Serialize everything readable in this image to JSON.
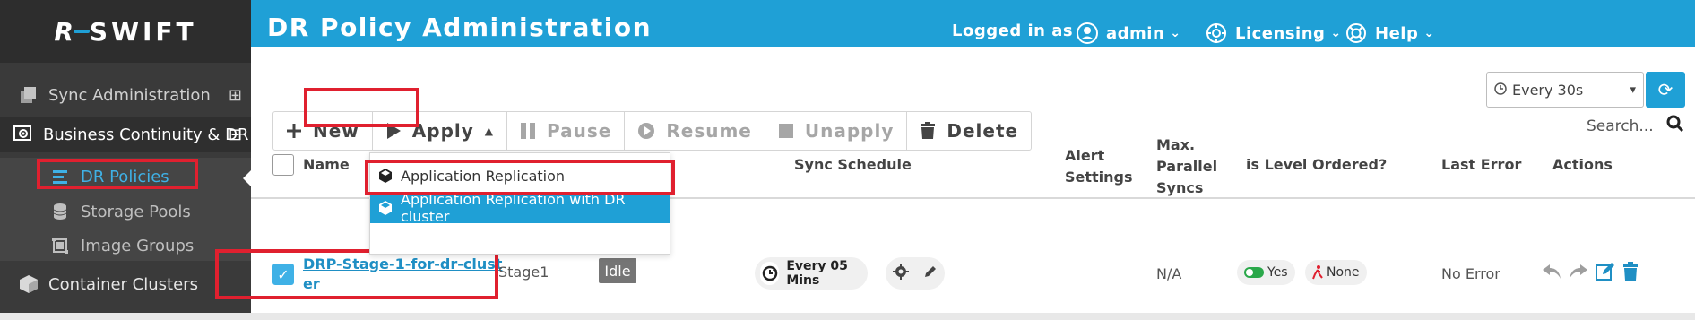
{
  "app": {
    "logo": "SWIFT"
  },
  "sidebar": {
    "items": [
      {
        "label": "Sync Administration",
        "expander": "⊞"
      },
      {
        "label": "Business Continuity & DR",
        "expander": "⊟"
      }
    ],
    "sub_items": [
      {
        "label": "DR Policies"
      },
      {
        "label": "Storage Pools"
      },
      {
        "label": "Image Groups"
      }
    ],
    "bottom_item": {
      "label": "Container Clusters"
    }
  },
  "header": {
    "title": "DR Policy Administration",
    "logged_in_label": "Logged in as",
    "user": "admin",
    "licensing": "Licensing",
    "help": "Help"
  },
  "refresh": {
    "selected": "Every 30s"
  },
  "toolbar": {
    "new": "New",
    "apply": "Apply",
    "pause": "Pause",
    "resume": "Resume",
    "unapply": "Unapply",
    "delete": "Delete"
  },
  "search": {
    "placeholder": "Search..."
  },
  "apply_menu": {
    "options": [
      "Application Replication",
      "Application Replication with DR cluster"
    ],
    "highlighted_index": 1
  },
  "table": {
    "columns": {
      "name": "Name",
      "sync_schedule": "Sync Schedule",
      "alert_settings_l1": "Alert",
      "alert_settings_l2": "Settings",
      "max_l1": "Max.",
      "max_l2": "Parallel",
      "max_l3": "Syncs",
      "level_ordered": "is Level Ordered?",
      "last_error": "Last Error",
      "actions": "Actions"
    },
    "rows": [
      {
        "name_l1": "DRP-Stage-1-for-dr-clust",
        "name_l2": "er",
        "stage": "Stage1",
        "status": "Idle",
        "schedule": "Every 05 Mins",
        "max_parallel": "N/A",
        "level_ordered": "Yes",
        "level_ordered_extra": "None",
        "last_error": "No Error",
        "selected": true
      }
    ]
  },
  "colors": {
    "accent": "#1fa0d6",
    "highlight_box": "#e0202f",
    "sidebar_bg": "#3a3a3a"
  }
}
